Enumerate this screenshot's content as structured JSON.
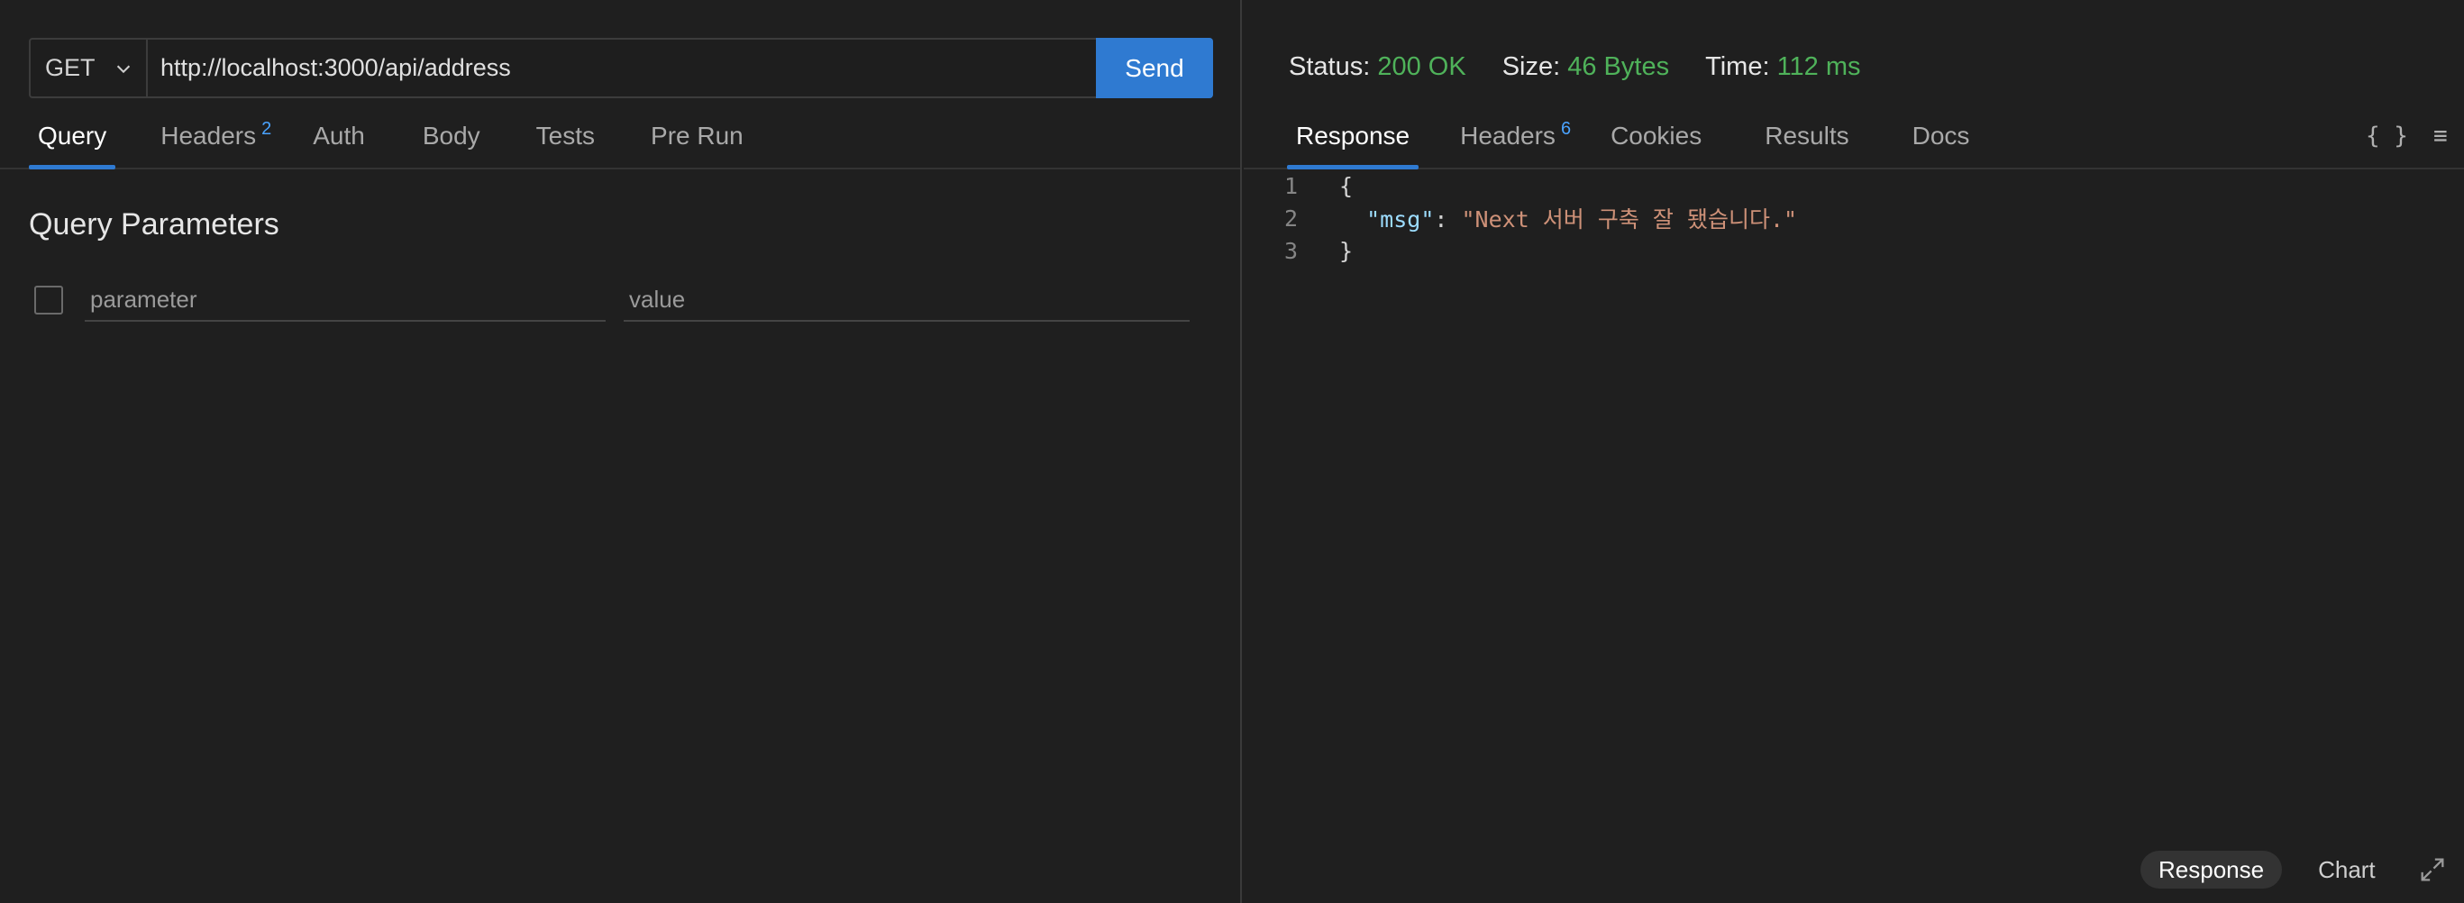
{
  "request": {
    "method": "GET",
    "url": "http://localhost:3000/api/address",
    "send_label": "Send"
  },
  "request_tabs": [
    {
      "label": "Query",
      "badge": ""
    },
    {
      "label": "Headers",
      "badge": "2"
    },
    {
      "label": "Auth",
      "badge": ""
    },
    {
      "label": "Body",
      "badge": ""
    },
    {
      "label": "Tests",
      "badge": ""
    },
    {
      "label": "Pre Run",
      "badge": ""
    }
  ],
  "query": {
    "title": "Query Parameters",
    "param_placeholder": "parameter",
    "value_placeholder": "value"
  },
  "response_status": {
    "status_label": "Status:",
    "status_value": "200 OK",
    "size_label": "Size:",
    "size_value": "46 Bytes",
    "time_label": "Time:",
    "time_value": "112 ms"
  },
  "response_tabs": [
    {
      "label": "Response",
      "badge": ""
    },
    {
      "label": "Headers",
      "badge": "6"
    },
    {
      "label": "Cookies",
      "badge": ""
    },
    {
      "label": "Results",
      "badge": ""
    },
    {
      "label": "Docs",
      "badge": ""
    }
  ],
  "response_body": {
    "line_numbers": [
      "1",
      "2",
      "3"
    ],
    "open_brace": "{",
    "key": "\"msg\"",
    "colon": ": ",
    "value": "\"Next 서버 구축 잘 됐습니다.\"",
    "close_brace": "}"
  },
  "bottom_toggle": {
    "response_label": "Response",
    "chart_label": "Chart"
  },
  "icons": {
    "braces": "{ }",
    "menu": "≡"
  },
  "colors": {
    "accent": "#2f7ad1",
    "success": "#4fb25a",
    "badge": "#4aa3ff"
  }
}
